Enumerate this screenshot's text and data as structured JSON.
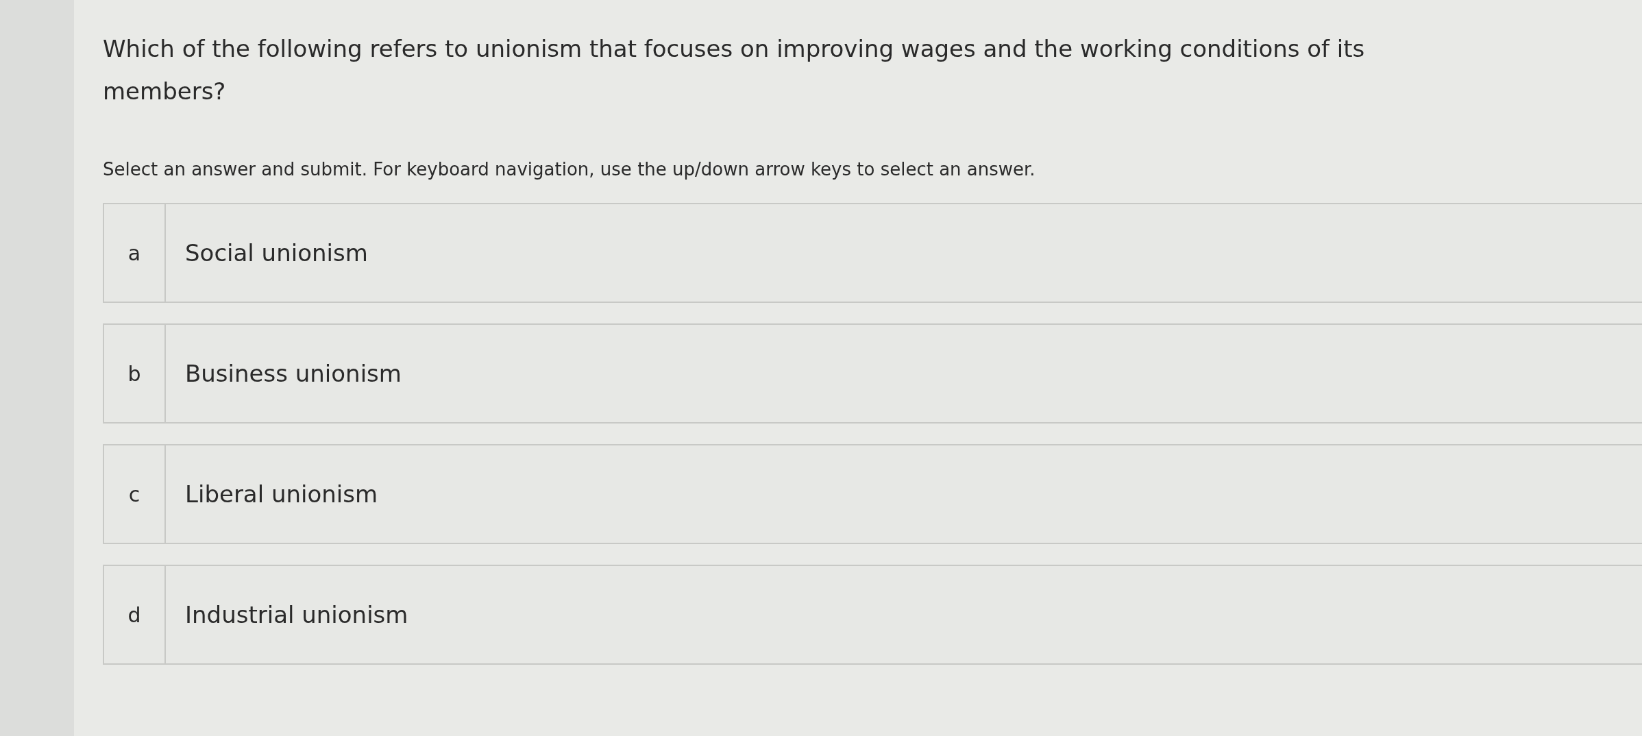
{
  "question": "Which of the following refers to unionism that focuses on improving wages and the working conditions of its members?",
  "instruction": "Select an answer and submit. For keyboard navigation, use the up/down arrow keys to select an answer.",
  "options": [
    {
      "letter": "a",
      "text": "Social unionism"
    },
    {
      "letter": "b",
      "text": "Business unionism"
    },
    {
      "letter": "c",
      "text": "Liberal unionism"
    },
    {
      "letter": "d",
      "text": "Industrial unionism"
    }
  ]
}
